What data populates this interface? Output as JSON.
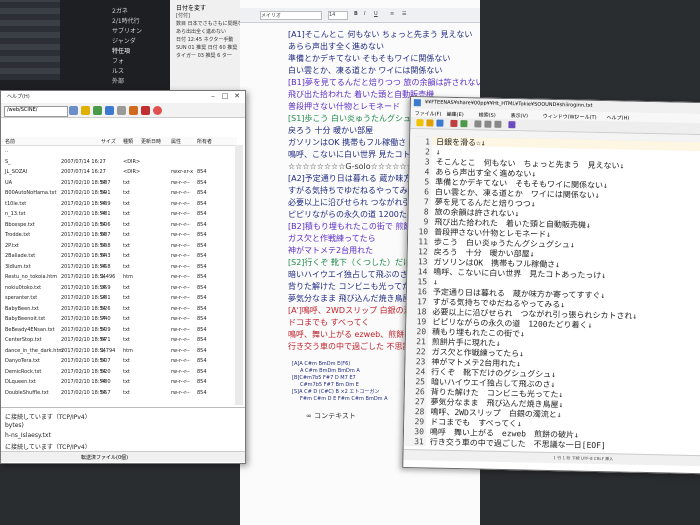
{
  "dark_app": {
    "nav": [
      "2ガネ",
      "2/1時代行",
      "サブリオン",
      "ジャンダ",
      "特任項",
      "フォ",
      "ルス",
      "外部"
    ],
    "selected_index": 4
  },
  "info_panel": {
    "header": "日付を変す",
    "rows": [
      "[付付]",
      "数目 日本でさもさもに問題ない",
      "あら出出全く進めない",
      "日付 12:45 ネクター手動  ",
      "SUN 01 推奨 日付 60 推奨",
      "タイガー 03 推奨 6 タ一"
    ]
  },
  "center_editor": {
    "toolbar_font": "メイリオ",
    "toolbar_size": "14",
    "lines": [
      {
        "text": "[A1]そこんとこ 何もない ちょっと先まう 見えない",
        "color": "#1f2a80"
      },
      {
        "text": "あらら声出す全く進めない",
        "color": "#1f2a80"
      },
      {
        "text": "準備とかデキてない そもそもワイに関係ない",
        "color": "#1f2a80"
      },
      {
        "text": "白い雲とか、凍る道とか ワイには関係ない",
        "color": "#1f2a80"
      },
      {
        "text": "[B1]夢を見てるんだと焙りつつ 旅の余韻は許されない",
        "color": "#5a2dc6"
      },
      {
        "text": "飛び出た拾われた 着いた頭と自動販売機",
        "color": "#5a2dc6"
      },
      {
        "text": "普段押さない什物とレモネード",
        "color": "#5a2dc6"
      },
      {
        "text": "[S1]歩こう 白い炎ゅうたんグシュグ",
        "color": "#1f8a4a"
      },
      {
        "text": "戻ろう 十分 暖かい部屋",
        "color": "#1f2a80"
      },
      {
        "text": "ガソリンはOK 携帯もフル稼働さ",
        "color": "#1f2a80"
      },
      {
        "text": "鳴呼、こないに白い世界 見たコト",
        "color": "#1f2a80"
      },
      {
        "text": "☆☆☆☆☆☆☆☆G-solo☆☆☆☆☆☆☆",
        "color": "#333333"
      },
      {
        "text": "[A2]予定通り日は暮れる 蔵か味方か",
        "color": "#1f2a80"
      },
      {
        "text": "すがる気持ちでゆだねるやってみる",
        "color": "#1f2a80"
      },
      {
        "text": "必要以上に沿びせられ つながれ引っ",
        "color": "#1f2a80"
      },
      {
        "text": "ピピリながらの永久の道 1200たとり",
        "color": "#1f2a80"
      },
      {
        "text": "[B2]積もり埋もれたこの街で 煎餅",
        "color": "#5a2dc6"
      },
      {
        "text": "ガス欠と作戦練ってたら",
        "color": "#5a2dc6"
      },
      {
        "text": "神がマトメテ2台用れた",
        "color": "#5a2dc6"
      },
      {
        "text": "[S2]行くぞ 靴下（くつした）だけ",
        "color": "#1f8a4a"
      },
      {
        "text": "暗いハイウエイ独占して飛ぶのさ",
        "color": "#1f2a80"
      },
      {
        "text": "背りた解けた コンビニも光ってた",
        "color": "#1f2a80"
      },
      {
        "text": "夢気分なまま 飛び込んだ焼き鳥屋",
        "color": "#1f2a80"
      },
      {
        "text": "[A']鳴呼、2WDスリップ 白銀の濁流",
        "color": "#c0202a"
      },
      {
        "text": "ドコまでも すべってく",
        "color": "#c0202a"
      },
      {
        "text": "鳴呼、舞い上がる ezweb、煎餅の",
        "color": "#c0202a"
      },
      {
        "text": "行き交う車の中で過ごした 不思議な",
        "color": "#c0202a"
      }
    ],
    "chords": [
      "[A]A C#m BmDm E(F6)",
      "A C#m BmDm BmDm A",
      "[B]C#m7b5 F#7 D M7 E7",
      "C#m7b5 F#7 Bm Dm E",
      "[S]A C# D (C#C) B ×2 エトコーガン",
      "F#m C#m D E F#m C#m BmDm A"
    ],
    "logo_text": "コンテキスト"
  },
  "file_manager": {
    "title": "ヘルプ(H)",
    "path_value": "/web/SCINE/",
    "columns": [
      "名前",
      "サイズ",
      "種類",
      "更新日時",
      "属性",
      "所有者"
    ],
    "rows": [
      [
        "..",
        "",
        "",
        "",
        "",
        ""
      ],
      [
        "S_",
        "",
        "<DIR>",
        "2007/07/14 16:27",
        "",
        ""
      ],
      [
        "JL_SOZAI",
        "",
        "<DIR>",
        "2007/07/14 16:27",
        "rwxr-xr-x",
        "854"
      ],
      [
        "UA",
        "587",
        "txt",
        "2017/02/10 18:54",
        "rw-r--r--",
        "854"
      ],
      [
        "B00AutoNoHama.txt",
        "591",
        "txt",
        "2017/02/10 18:54",
        "rw-r--r--",
        "854"
      ],
      [
        "t10le.txt",
        "439",
        "txt",
        "2017/02/10 18:54",
        "rw-r--r--",
        "854"
      ],
      [
        "n_13.txt",
        "481",
        "txt",
        "2017/02/10 18:54",
        "rw-r--r--",
        "854"
      ],
      [
        "Bboxspe.txt",
        "506",
        "txt",
        "2017/02/10 18:54",
        "rw-r--r--",
        "854"
      ],
      [
        "Trodde.txt",
        "687",
        "txt",
        "2017/02/10 18:54",
        "rw-r--r--",
        "854"
      ],
      [
        "2P.txt",
        "538",
        "txt",
        "2017/02/10 18:54",
        "rw-r--r--",
        "854"
      ],
      [
        "2Ballade.txt",
        "643",
        "txt",
        "2017/02/10 18:54",
        "rw-r--r--",
        "854"
      ],
      [
        "3Idlum.txt",
        "468",
        "txt",
        "2017/02/10 18:54",
        "rw-r--r--",
        "854"
      ],
      [
        "Restu_no_tokoia.htm",
        "1,496",
        "htm",
        "2017/02/10 18:54",
        "rw-r--r--",
        "854"
      ],
      [
        "nokiu0toko.txt",
        "359",
        "txt",
        "2017/02/10 18:54",
        "rw-r--r--",
        "854"
      ],
      [
        "speranter.txt",
        "281",
        "txt",
        "2017/02/10 18:54",
        "rw-r--r--",
        "854"
      ],
      [
        "BabyBeen.txt",
        "526",
        "txt",
        "2017/02/10 18:54",
        "rw-r--r--",
        "854"
      ],
      [
        "BabyBeenoit.txt",
        "740",
        "txt",
        "2017/02/10 18:54",
        "rw-r--r--",
        "854"
      ],
      [
        "BeBeady4ENsan.txt",
        "509",
        "txt",
        "2017/02/10 18:54",
        "rw-r--r--",
        "854"
      ],
      [
        "CenterStop.txt",
        "671",
        "txt",
        "2017/02/10 18:54",
        "rw-r--r--",
        "854"
      ],
      [
        "dance_in_the_dark.htm",
        "1,794",
        "htm",
        "2017/02/10 18:54",
        "rw-r--r--",
        "854"
      ],
      [
        "DanyoTera.txt",
        "507",
        "txt",
        "2017/02/10 18:54",
        "rw-r--r--",
        "854"
      ],
      [
        "DemicRock.txt",
        "520",
        "txt",
        "2017/02/10 18:54",
        "rw-r--r--",
        "854"
      ],
      [
        "DLqueen.txt",
        "480",
        "txt",
        "2017/02/10 18:54",
        "rw-r--r--",
        "854"
      ],
      [
        "DoubleShuffle.txt",
        "557",
        "txt",
        "2017/02/10 18:54",
        "rw-r--r--",
        "854"
      ]
    ],
    "log_lines": [
      "に接続しています（TCP/IPv4）",
      "bytes)",
      "h-ns_Islaesy.txt",
      "に接続しています（TCP/IPv4）",
      "Bytes)"
    ],
    "status": "転送済ファイル(0個)"
  },
  "text_editor": {
    "title": "¥¥FTEENAS¥share¥00pp¥¥Ht_HTML¥Tokie¥SOOUND¥shiiroginn.txt",
    "menus": [
      "ファイル(F)",
      "編集(E)",
      "検索(S)",
      "表示(V)",
      "ウィンドウ(W)",
      "ツール(T)",
      "ヘルプ(H)"
    ],
    "lines": [
      "日銀を滑る☆↓",
      "↓",
      "そこんとこ　何もない　ちょっと先まう　見えない↓",
      "あらら声出す全く進めない↓",
      "準備とかデキてない　そもそもワイに関係ない↓",
      "白い雲とか、凍る道とか　ワイには関係ない↓",
      "夢を見てるんだと焙りつつ↓",
      "旅の余韻は許されない↓",
      "飛び出た拾われた　着いた頭と自動販売機↓",
      "普段押さない什物とレモネード↓",
      "歩こう　白い炎ゅうたんグシュグシュ↓",
      "戻ろう　十分　暖かい部屋↓",
      "ガソリンはOK　携帯もフル稼働さ↓",
      "鳴呼、こないに白い世界　見たコトあったっけ↓",
      "↓",
      "予定通り日は暮れる　蔵か味方か寄ってすすぐ↓",
      "すがる気持ちでゆだねるやってみる↓",
      "必要以上に沿びせられ　つながれ引っ張られシカトされ↓",
      "ピピリながらの永久の道　1200たどり着く↓",
      "積もり埋もれたこの街で↓",
      "煎餅片手に現れた↓",
      "ガス欠と作戦練ってたら↓",
      "神がマトメテ2台用れた↓",
      "行くぞ　靴下だけのグシュグシュ↓",
      "暗いハイウエイ独占して飛ぶのさ↓",
      "背りた解けた　コンビニも光ってた↓",
      "夢気分なまま　飛び込んだ焼き鳥屋↓",
      "鳴呼、2WDスリップ　白銀の濁流と↓",
      "ドコまでも　すべってく↓",
      "鳴呼　舞い上がる　ezweb　煎餅の破片↓",
      "行き交う車の中で過ごした　不思議な一日[EOF]"
    ],
    "status": "1 行 1 桁   下線   UTF-8   CRLF   挿入"
  }
}
